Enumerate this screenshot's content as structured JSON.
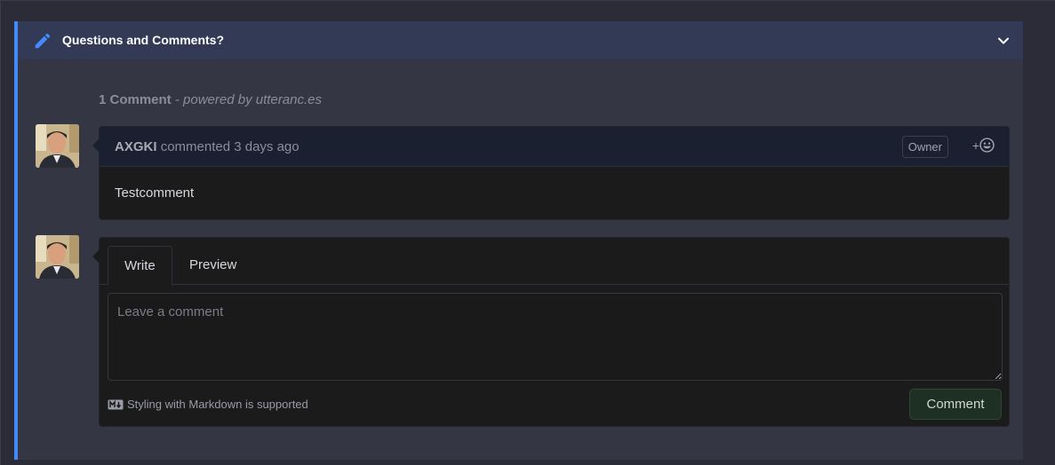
{
  "panel": {
    "title": "Questions and Comments?",
    "accent_color": "#448aff",
    "icons": {
      "header": "pencil-icon",
      "toggle": "chevron-down-icon"
    }
  },
  "comments_summary": {
    "count_label": "1 Comment",
    "powered_by": "- powered by utteranc.es"
  },
  "comment": {
    "author": "AXGKI",
    "action": "commented 3 days ago",
    "badge": "Owner",
    "reaction_plus": "+",
    "body": "Testcomment"
  },
  "compose": {
    "tabs": [
      {
        "label": "Write",
        "active": true
      },
      {
        "label": "Preview",
        "active": false
      }
    ],
    "placeholder": "Leave a comment",
    "markdown_hint": "Styling with Markdown is supported",
    "submit_label": "Comment"
  }
}
